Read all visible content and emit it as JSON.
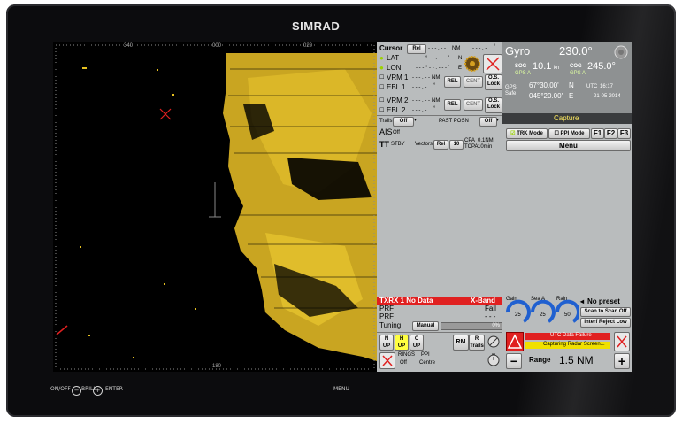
{
  "brand": "SIMRAD",
  "hardware": {
    "onoff": "ON/OFF",
    "minus": "−",
    "brill": "BRILL",
    "plus": "+",
    "enter": "ENTER",
    "menu": "MENU"
  },
  "cursor": {
    "label": "Cursor",
    "mode": "Rel",
    "range_value": "- - - . - -",
    "range_unit": "NM",
    "bearing_value": "- - - . -",
    "bearing_unit": "°"
  },
  "lat": {
    "label": "LAT",
    "value": "- - - ° - - . - - - '",
    "hemi": "N"
  },
  "lon": {
    "label": "LON",
    "value": "- - - ° - - . - - - '",
    "hemi": "E"
  },
  "vrm1": {
    "label": "VRM 1",
    "value": "- - - . - -",
    "unit": "NM"
  },
  "ebl1": {
    "label": "EBL 1",
    "value": "- - - . -",
    "unit": "°"
  },
  "vrm2": {
    "label": "VRM 2",
    "value": "- - - . - -",
    "unit": "NM"
  },
  "ebl2": {
    "label": "EBL 2",
    "value": "- - - . -",
    "unit": "°"
  },
  "btn_rel": "REL",
  "btn_cent": "CENT",
  "btn_os_lock": "O.S. Lock",
  "trails": {
    "label": "Trails",
    "value": "Off"
  },
  "past_posn": {
    "label": "PAST POSN",
    "value": "Off"
  },
  "ais": {
    "label": "AIS",
    "value": "Off"
  },
  "tt": {
    "label": "TT",
    "stby": "STBY",
    "vectors_label": "Vectors",
    "vectors_mode": "Rel",
    "vectors_value": "10",
    "cpa": "CPA",
    "cpa_value": "0.1NM",
    "tcpa": "TCPA",
    "tcpa_value": "10min"
  },
  "gyro": {
    "label": "Gyro",
    "value": "230.0°",
    "sog_label": "SOG",
    "sog_value": "10.1",
    "sog_unit": "kn",
    "sog_src": "GPS A",
    "cog_label": "COG",
    "cog_value": "245.0°",
    "cog_src": "GPS A",
    "gps_label": "GPS",
    "gps_state": "Safe",
    "lat": "67°30.00'",
    "lat_h": "N",
    "lon": "045°20.00'",
    "lon_h": "E",
    "utc_label": "UTC",
    "utc_time": "16:17",
    "date": "21-05-2014"
  },
  "capture": "Capture",
  "trk_mode": "TRK Mode",
  "ppi_mode": "PPI Mode",
  "f1": "F1",
  "f2": "F2",
  "f3": "F3",
  "menu": "Menu",
  "txrx": {
    "status": "TXRX 1 No Data",
    "band": "X-Band",
    "prf_label": "PRF",
    "prf_value": "Fail",
    "prf2_label": "PRF",
    "prf2_value": "- - -",
    "tuning_label": "Tuning",
    "tuning_mode": "Manual",
    "tuning_value": "0%"
  },
  "gauges": [
    {
      "label": "Gain",
      "value": "25"
    },
    {
      "label": "Sea A",
      "value": "25"
    },
    {
      "label": "Rain",
      "value": "50"
    }
  ],
  "preset": {
    "label": "No preset",
    "scan": "Scan to Scan Off",
    "interf": "Interf Reject Low"
  },
  "orient": [
    {
      "top": "N",
      "bottom": "UP"
    },
    {
      "top": "H",
      "bottom": "UP"
    },
    {
      "top": "C",
      "bottom": "UP"
    }
  ],
  "rm": "RM",
  "r_trails": {
    "top": "R",
    "bottom": "Trails"
  },
  "rings": {
    "label": "RINGS",
    "value": "Off",
    "ppi_label": "PPI",
    "ppi_value": "Centre"
  },
  "alarm": {
    "line1": "UTC Data Failure",
    "line2": "Capturing Radar Screen..."
  },
  "range": {
    "label": "Range",
    "value": "1.5 NM",
    "minus": "−",
    "plus": "+"
  },
  "radar_ticks": {
    "top1": "340",
    "top2": "000",
    "top3": "020",
    "bottom": "180"
  },
  "colors": {
    "echo": "#e6c020",
    "alarm_red": "#e02020",
    "accent_green": "#9ad200",
    "panel": "#b9bcbd"
  }
}
